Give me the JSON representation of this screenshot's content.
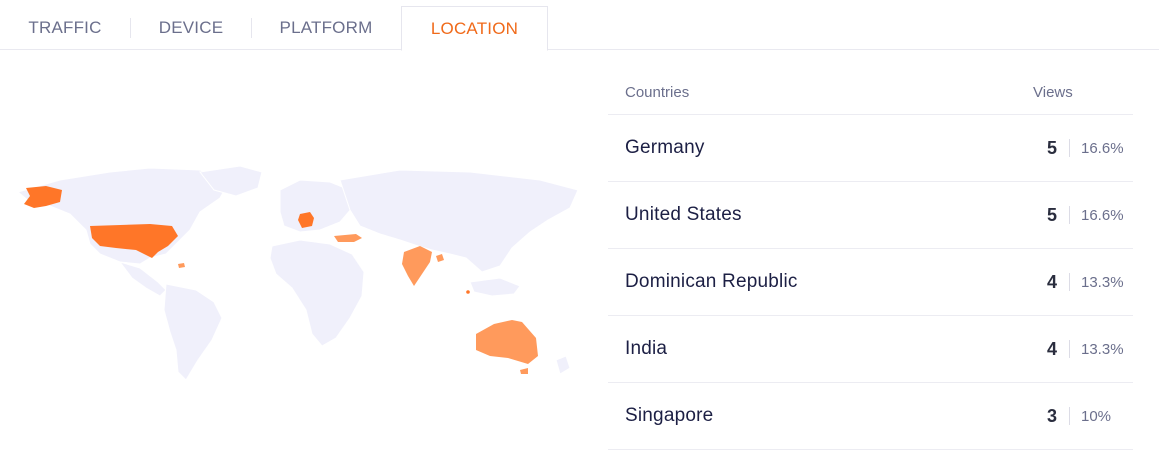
{
  "tabs": [
    {
      "label": "TRAFFIC",
      "active": false
    },
    {
      "label": "DEVICE",
      "active": false
    },
    {
      "label": "PLATFORM",
      "active": false
    },
    {
      "label": "LOCATION",
      "active": true
    }
  ],
  "colors": {
    "accent": "#f06a1a",
    "map_base": "#f0f0fb",
    "map_high": "#ff7628",
    "map_mid": "#ff9a5c"
  },
  "table": {
    "header": {
      "country": "Countries",
      "views": "Views"
    },
    "rows": [
      {
        "country": "Germany",
        "views": "5",
        "pct": "16.6%"
      },
      {
        "country": "United States",
        "views": "5",
        "pct": "16.6%"
      },
      {
        "country": "Dominican Republic",
        "views": "4",
        "pct": "13.3%"
      },
      {
        "country": "India",
        "views": "4",
        "pct": "13.3%"
      },
      {
        "country": "Singapore",
        "views": "3",
        "pct": "10%"
      }
    ]
  }
}
